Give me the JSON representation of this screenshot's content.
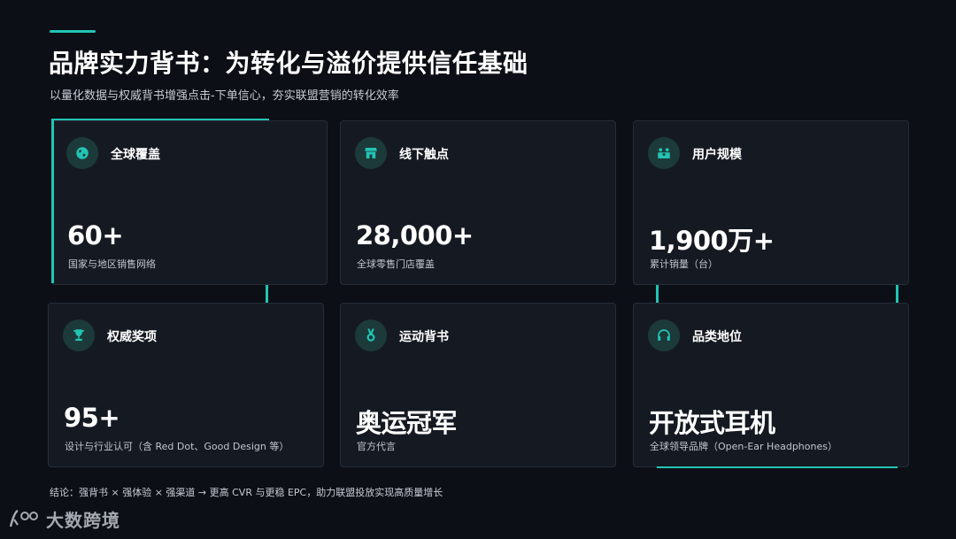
{
  "header": {
    "title": "品牌实力背书：为转化与溢价提供信任基础",
    "subtitle": "以量化数据与权威背书增强点击-下单信心，夯实联盟营销的转化效率"
  },
  "cards": [
    {
      "icon": "globe-icon",
      "label": "全球覆盖",
      "value": "60+",
      "desc": "国家与地区销售网络"
    },
    {
      "icon": "store-icon",
      "label": "线下触点",
      "value": "28,000+",
      "desc": "全球零售门店覆盖"
    },
    {
      "icon": "users-icon",
      "label": "用户规模",
      "value": "1,900万+",
      "desc": "累计销量（台）"
    },
    {
      "icon": "trophy-icon",
      "label": "权威奖项",
      "value": "95+",
      "desc": "设计与行业认可（含 Red Dot、Good Design 等）"
    },
    {
      "icon": "medal-icon",
      "label": "运动背书",
      "value": "奥运冠军",
      "desc": "官方代言"
    },
    {
      "icon": "headphones-icon",
      "label": "品类地位",
      "value": "开放式耳机",
      "desc": "全球领导品牌（Open-Ear Headphones）"
    }
  ],
  "footer": {
    "conclusion": "结论：强背书 × 强体验 × 强渠道 → 更高 CVR 与更稳 EPC，助力联盟投放实现高质量增长",
    "logo_text": "大数跨境"
  },
  "colors": {
    "accent": "#22c4b4",
    "background": "#0c0f15",
    "card": "#151a22"
  }
}
